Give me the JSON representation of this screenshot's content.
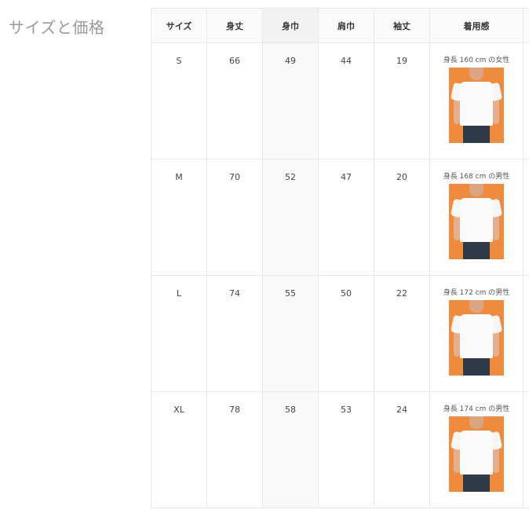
{
  "section_title": "サイズと価格",
  "headers": {
    "size": "サイズ",
    "length": "身丈",
    "width": "身巾",
    "shoulder": "肩巾",
    "sleeve": "袖丈",
    "fit": "着用感"
  },
  "rows": [
    {
      "size": "S",
      "length": "66",
      "width": "49",
      "shoulder": "44",
      "sleeve": "19",
      "fit_caption": "身長 160 cm の女性"
    },
    {
      "size": "M",
      "length": "70",
      "width": "52",
      "shoulder": "47",
      "sleeve": "20",
      "fit_caption": "身長 168 cm の男性"
    },
    {
      "size": "L",
      "length": "74",
      "width": "55",
      "shoulder": "50",
      "sleeve": "22",
      "fit_caption": "身長 172 cm の男性"
    },
    {
      "size": "XL",
      "length": "78",
      "width": "58",
      "shoulder": "53",
      "sleeve": "24",
      "fit_caption": "身長 174 cm の男性"
    }
  ],
  "colors": {
    "photo_background": "#f08a3c",
    "title": "#999999",
    "border": "#e8e8e8"
  }
}
